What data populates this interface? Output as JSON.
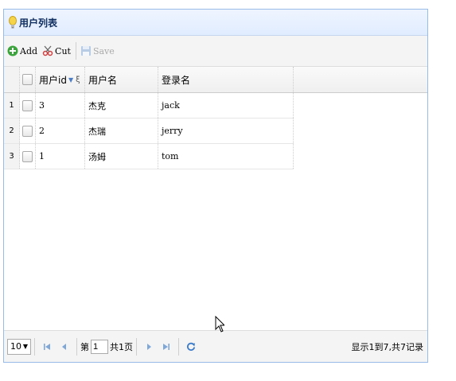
{
  "panel": {
    "title": "用户列表"
  },
  "toolbar": {
    "add_label": "Add",
    "cut_label": "Cut",
    "save_label": "Save"
  },
  "grid": {
    "columns": [
      "用户id",
      "用户名",
      "登录名"
    ],
    "rows": [
      {
        "num": "1",
        "id": "3",
        "name": "杰克",
        "login": "jack"
      },
      {
        "num": "2",
        "id": "2",
        "name": "杰瑞",
        "login": "jerry"
      },
      {
        "num": "3",
        "id": "1",
        "name": "汤姆",
        "login": "tom"
      }
    ]
  },
  "pager": {
    "page_size": "10",
    "page_prefix": "第",
    "page_value": "1",
    "page_suffix": "共1页",
    "info": "显示1到7,共7记录"
  },
  "colors": {
    "accent": "#99bbe8",
    "header_bg": "#e0ecff",
    "title_text": "#0e2d5f"
  }
}
